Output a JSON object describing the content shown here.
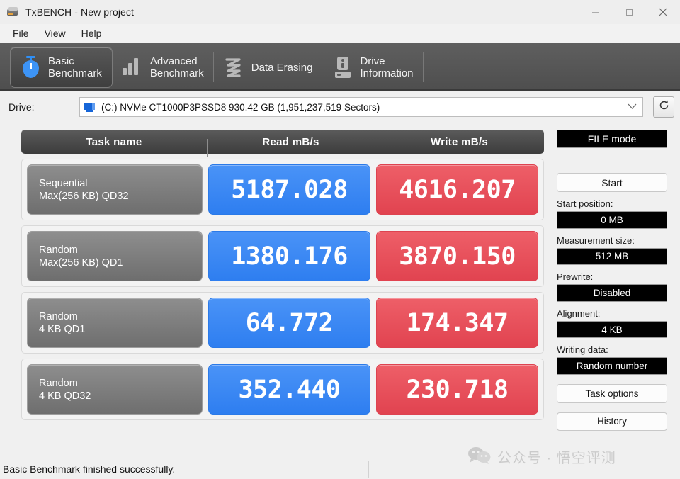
{
  "window": {
    "title": "TxBENCH - New project",
    "app_icon": "txbench-app-icon",
    "minimize": "–",
    "maximize": "□",
    "close": "×"
  },
  "menubar": {
    "items": [
      {
        "label": "File"
      },
      {
        "label": "View"
      },
      {
        "label": "Help"
      }
    ]
  },
  "tabs": [
    {
      "label": "Basic\nBenchmark",
      "icon": "stopwatch-icon",
      "active": true
    },
    {
      "label": "Advanced\nBenchmark",
      "icon": "bar-chart-icon",
      "active": false
    },
    {
      "label": "Data Erasing",
      "icon": "shredder-icon",
      "active": false
    },
    {
      "label": "Drive\nInformation",
      "icon": "hard-drive-icon",
      "active": false
    }
  ],
  "drive": {
    "label": "Drive:",
    "value": "(C:) NVMe CT1000P3PSSD8  930.42 GB (1,951,237,519 Sectors)",
    "icon": "drive-small-icon",
    "dropdown_icon": "chevron-down-icon",
    "refresh_icon": "refresh-icon"
  },
  "results": {
    "columns": [
      "Task name",
      "Read mB/s",
      "Write mB/s"
    ],
    "rows": [
      {
        "task_line1": "Sequential",
        "task_line2": "Max(256 KB) QD32",
        "read": "5187.028",
        "write": "4616.207"
      },
      {
        "task_line1": "Random",
        "task_line2": "Max(256 KB) QD1",
        "read": "1380.176",
        "write": "3870.150"
      },
      {
        "task_line1": "Random",
        "task_line2": "4 KB QD1",
        "read": "64.772",
        "write": "174.347"
      },
      {
        "task_line1": "Random",
        "task_line2": "4 KB QD32",
        "read": "352.440",
        "write": "230.718"
      }
    ]
  },
  "panel": {
    "file_mode": "FILE mode",
    "start": "Start",
    "start_position_label": "Start position:",
    "start_position_value": "0 MB",
    "measurement_size_label": "Measurement size:",
    "measurement_size_value": "512 MB",
    "prewrite_label": "Prewrite:",
    "prewrite_value": "Disabled",
    "alignment_label": "Alignment:",
    "alignment_value": "4 KB",
    "writing_data_label": "Writing data:",
    "writing_data_value": "Random number",
    "task_options": "Task options",
    "history": "History"
  },
  "watermark": {
    "icon": "wechat-icon",
    "text": "公众号 · 悟空评测"
  },
  "statusbar": {
    "message": "Basic Benchmark finished successfully."
  },
  "colors": {
    "read_blue": "#3d8bf5",
    "write_red": "#e8505b",
    "tab_bar": "#585858",
    "panel_field_bg": "#000000"
  }
}
